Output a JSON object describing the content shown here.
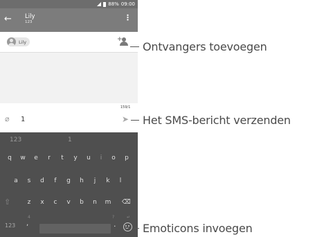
{
  "statusbar": {
    "battery": "88%",
    "time": "09:00"
  },
  "appbar": {
    "back_icon": "←",
    "title": "Lily",
    "subtitle": "123",
    "overflow_icon": "⋮"
  },
  "recipients": {
    "chip_label": "Lily"
  },
  "compose": {
    "counter": "159/1"
  },
  "attach_row": {
    "attach_icon": "⌀",
    "attach_count": "1",
    "send_icon": "➤"
  },
  "keyboard": {
    "suggestions": [
      "123",
      "1"
    ],
    "row1": [
      "q",
      "w",
      "e",
      "r",
      "t",
      "y",
      "u",
      "i",
      "o",
      "p"
    ],
    "row2": [
      "a",
      "s",
      "d",
      "f",
      "g",
      "h",
      "j",
      "k",
      "l"
    ],
    "row3": [
      "z",
      "x",
      "c",
      "v",
      "b",
      "n",
      "m"
    ],
    "shift_icon": "⇧",
    "backspace_icon": "⌫",
    "bottom": {
      "num_key": "123",
      "comma": ",",
      "comma_hint": "4",
      "dot": ".",
      "dot_hint": "?",
      "enter_hint": "↵"
    }
  },
  "callouts": {
    "add_recipients": "Ontvangers toevoegen",
    "send_sms": "Het SMS-bericht verzenden",
    "insert_emoticons": "Emoticons invoegen"
  }
}
